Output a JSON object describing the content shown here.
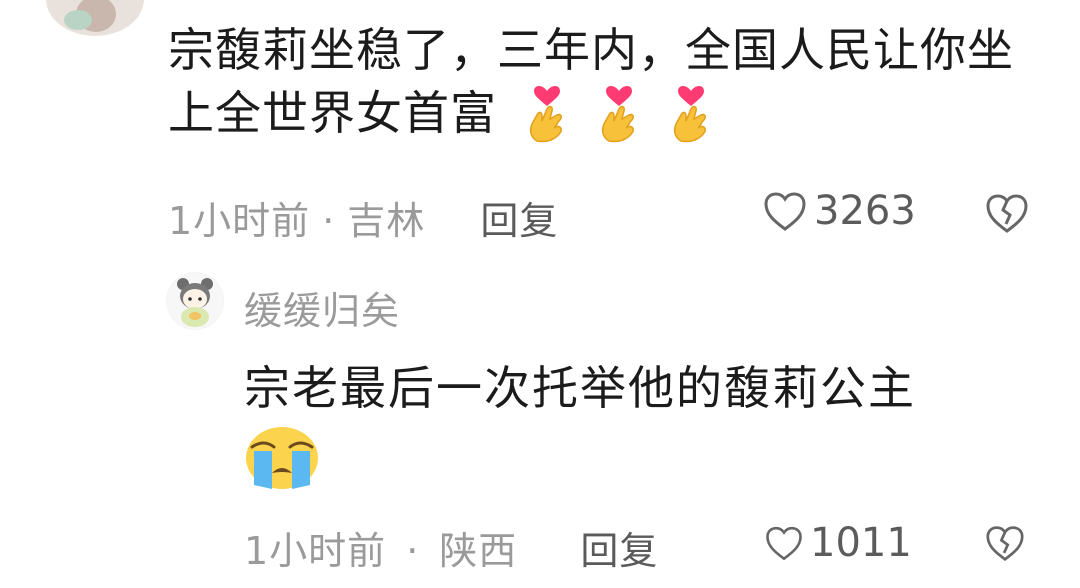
{
  "comment": {
    "text": "宗馥莉坐稳了，三年内，全国人民让你坐上全世界女首富",
    "emojis": [
      "heart-hands-emoji",
      "heart-hands-emoji",
      "heart-hands-emoji"
    ],
    "time": "1小时前",
    "location": "吉林",
    "reply_label": "回复",
    "likes": "3263"
  },
  "reply": {
    "author": "缓缓归矣",
    "text": "宗老最后一次托举他的馥莉公主",
    "emoji": "loudly-crying-face-emoji",
    "time": "1小时前",
    "location": "陕西",
    "reply_label": "回复",
    "likes": "1011"
  },
  "colors": {
    "meta": "#9a9a9a",
    "text": "#1b1b1b"
  }
}
